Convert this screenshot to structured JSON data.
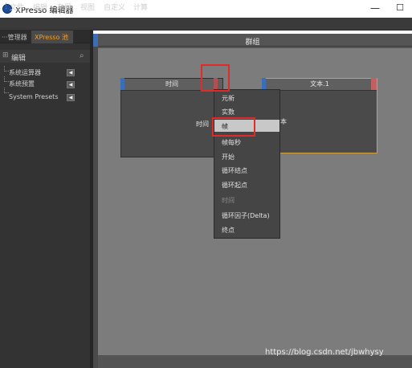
{
  "window": {
    "title": "XPresso 编辑器"
  },
  "menubar": {
    "items": [
      "文件",
      "编辑",
      "布局",
      "视图",
      "自定义",
      "计算"
    ]
  },
  "left_panel": {
    "tabs": [
      "···管理器",
      "XPresso 池"
    ],
    "search_label": "编辑",
    "tree": [
      {
        "label": "系统运算器",
        "flag": "◀"
      },
      {
        "label": "系统预置",
        "flag": "◀"
      },
      {
        "label": "System Presets",
        "flag": "◀"
      }
    ]
  },
  "canvas": {
    "title": "群组",
    "nodes": {
      "time": {
        "title": "时间",
        "port": "时间"
      },
      "text": {
        "title": "文本.1",
        "port": "本"
      }
    },
    "context_menu": {
      "items": [
        {
          "label": "元新",
          "disabled": false,
          "highlighted": false
        },
        {
          "label": "实数",
          "disabled": false,
          "highlighted": false
        },
        {
          "label": "帧",
          "disabled": false,
          "highlighted": true
        },
        {
          "label": "帧每秒",
          "disabled": false,
          "highlighted": false
        },
        {
          "label": "开始",
          "disabled": false,
          "highlighted": false
        },
        {
          "label": "循环结点",
          "disabled": false,
          "highlighted": false
        },
        {
          "label": "循环起点",
          "disabled": false,
          "highlighted": false
        },
        {
          "label": "时间",
          "disabled": true,
          "highlighted": false
        },
        {
          "label": "循环因子(Delta)",
          "disabled": false,
          "highlighted": false
        },
        {
          "label": "终点",
          "disabled": false,
          "highlighted": false
        }
      ]
    }
  },
  "watermark": "https://blog.csdn.net/jbwhysy",
  "colors": {
    "accent": "#f0a030",
    "port_in": "#3a6fb8",
    "port_out": "#b05050",
    "annotation": "#e02b2b",
    "selected_node_border": "#d4a040"
  },
  "icons": {
    "app": "cinema4d-logo-icon",
    "search": "magnifier-icon",
    "window_min": "minimize-icon",
    "window_max": "maximize-icon"
  }
}
